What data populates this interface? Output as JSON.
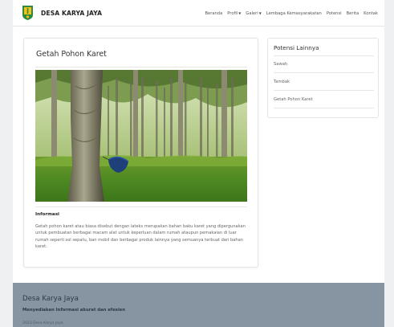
{
  "navbar": {
    "brand": "DESA KARYA JAYA",
    "items": [
      {
        "label": "Beranda",
        "dropdown": false
      },
      {
        "label": "Profil",
        "dropdown": true
      },
      {
        "label": "Galeri",
        "dropdown": true
      },
      {
        "label": "Lembaga Kemasyarakatan",
        "dropdown": false
      },
      {
        "label": "Potensi",
        "dropdown": false
      },
      {
        "label": "Berita",
        "dropdown": false
      },
      {
        "label": "Kontak",
        "dropdown": false
      }
    ]
  },
  "main": {
    "title": "Getah Pohon Karet",
    "image_icon": "rubber-tree-plantation-photo",
    "info_heading": "Informasi",
    "info_text": "Getah pohon karet atau biasa disebut dengan lateks merupakan bahan baku karet yang dipergunakan untuk pembuatan berbagai macam alat untuk keperluan dalam rumah ataupun pemakaian di luar rumah seperti sol sepatu, ban mobil dan berbagai produk lainnya yang semuanya terbuat dari bahan karet."
  },
  "sidebar": {
    "title": "Potensi Lainnya",
    "items": [
      {
        "label": "Sawah"
      },
      {
        "label": "Tambak"
      },
      {
        "label": "Getah Pohon Karet"
      }
    ]
  },
  "footer": {
    "title": "Desa Karya Jaya",
    "subtitle": "Menyediakan Informasi akurat dan efesien",
    "copyright": "2023 Desa Karya Jaya"
  },
  "colors": {
    "footer_bg": "#8795a3",
    "logo_green": "#2e8b3d",
    "logo_yellow": "#f2c21b"
  }
}
